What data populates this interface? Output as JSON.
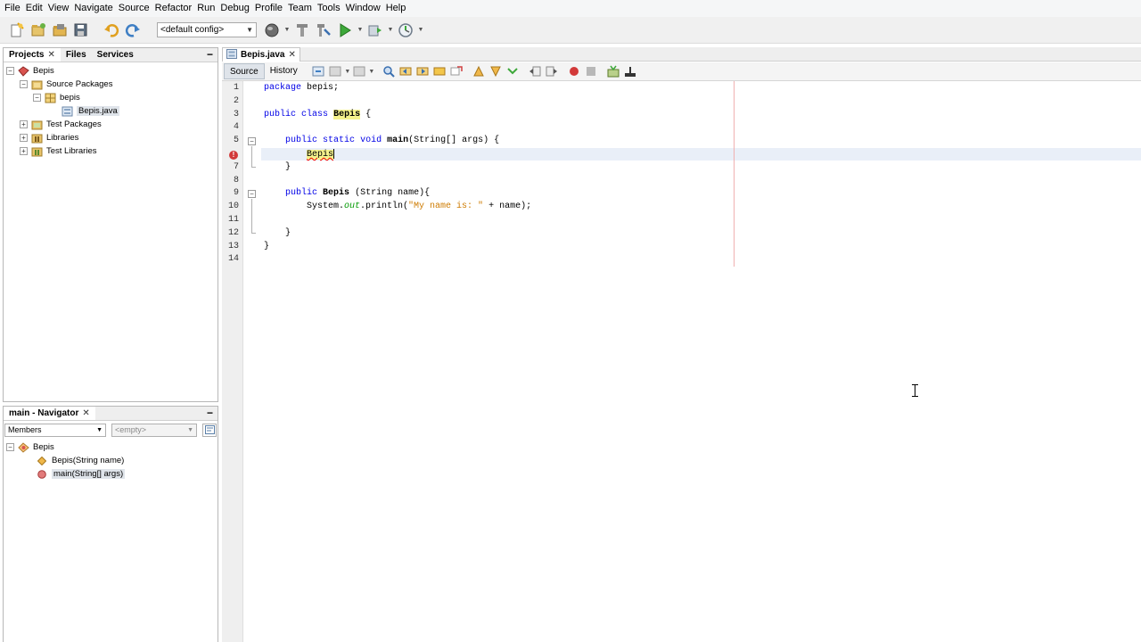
{
  "menu": [
    "File",
    "Edit",
    "View",
    "Navigate",
    "Source",
    "Refactor",
    "Run",
    "Debug",
    "Profile",
    "Team",
    "Tools",
    "Window",
    "Help"
  ],
  "toolbar": {
    "config_value": "<default config>",
    "icons": [
      "new-file-icon",
      "new-project-icon",
      "open-project-icon",
      "save-all-icon",
      "undo-icon",
      "redo-icon",
      "config-select",
      "globe-icon",
      "clean-build-icon",
      "build-icon",
      "run-icon",
      "debug-icon",
      "profile-icon"
    ]
  },
  "projects_panel": {
    "tabs": [
      {
        "label": "Projects",
        "active": true,
        "closable": true
      },
      {
        "label": "Files",
        "active": false,
        "closable": false
      },
      {
        "label": "Services",
        "active": false,
        "closable": false
      }
    ],
    "minimize_label": "−",
    "tree": [
      {
        "label": "Bepis",
        "level": 0,
        "toggle": "−",
        "icon": "project-icon"
      },
      {
        "label": "Source Packages",
        "level": 1,
        "toggle": "−",
        "icon": "source-packages-icon"
      },
      {
        "label": "bepis",
        "level": 2,
        "toggle": "−",
        "icon": "package-icon"
      },
      {
        "label": "Bepis.java",
        "level": 3,
        "toggle": "",
        "icon": "java-file-icon",
        "selected": true
      },
      {
        "label": "Test Packages",
        "level": 1,
        "toggle": "+",
        "icon": "test-packages-icon"
      },
      {
        "label": "Libraries",
        "level": 1,
        "toggle": "+",
        "icon": "libraries-icon"
      },
      {
        "label": "Test Libraries",
        "level": 1,
        "toggle": "+",
        "icon": "test-libraries-icon"
      }
    ]
  },
  "navigator": {
    "title": "main - Navigator",
    "members_label": "Members",
    "filter_placeholder": "<empty>",
    "tree": [
      {
        "label": "Bepis",
        "icon": "class-icon",
        "level": 0
      },
      {
        "label": "Bepis(String name)",
        "icon": "constructor-icon",
        "level": 1
      },
      {
        "label": "main(String[] args)",
        "icon": "method-icon",
        "level": 1,
        "selected": true
      }
    ]
  },
  "editor": {
    "file_tab": "Bepis.java",
    "view_tabs": [
      "Source",
      "History"
    ],
    "active_view": "Source",
    "lines": [
      {
        "num": "1",
        "code": [
          {
            "t": "package",
            "c": "kw"
          },
          {
            "t": " bepis;",
            "c": ""
          }
        ]
      },
      {
        "num": "2",
        "code": []
      },
      {
        "num": "3",
        "code": [
          {
            "t": "public",
            "c": "kw"
          },
          {
            "t": " ",
            "c": ""
          },
          {
            "t": "class",
            "c": "kw"
          },
          {
            "t": " ",
            "c": ""
          },
          {
            "t": "Bepis",
            "c": "cls hl"
          },
          {
            "t": " {",
            "c": ""
          }
        ]
      },
      {
        "num": "4",
        "code": []
      },
      {
        "num": "5",
        "code": [
          {
            "t": "    ",
            "c": ""
          },
          {
            "t": "public",
            "c": "kw"
          },
          {
            "t": " ",
            "c": ""
          },
          {
            "t": "static",
            "c": "kw"
          },
          {
            "t": " ",
            "c": ""
          },
          {
            "t": "void",
            "c": "kw"
          },
          {
            "t": " ",
            "c": ""
          },
          {
            "t": "main",
            "c": "cls"
          },
          {
            "t": "(String[] args) {",
            "c": ""
          }
        ]
      },
      {
        "num": "",
        "code": [
          {
            "t": "        ",
            "c": ""
          },
          {
            "t": "Bepis",
            "c": "hl err-underline"
          }
        ]
      },
      {
        "num": "7",
        "code": [
          {
            "t": "    }",
            "c": ""
          }
        ]
      },
      {
        "num": "8",
        "code": []
      },
      {
        "num": "9",
        "code": [
          {
            "t": "    ",
            "c": ""
          },
          {
            "t": "public",
            "c": "kw"
          },
          {
            "t": " ",
            "c": ""
          },
          {
            "t": "Bepis",
            "c": "cls"
          },
          {
            "t": " (String name){",
            "c": ""
          }
        ]
      },
      {
        "num": "10",
        "code": [
          {
            "t": "        System.",
            "c": ""
          },
          {
            "t": "out",
            "c": "fld"
          },
          {
            "t": ".println(",
            "c": ""
          },
          {
            "t": "\"My name is: \"",
            "c": "str"
          },
          {
            "t": " + name);",
            "c": ""
          }
        ]
      },
      {
        "num": "11",
        "code": []
      },
      {
        "num": "12",
        "code": [
          {
            "t": "    }",
            "c": ""
          }
        ]
      },
      {
        "num": "13",
        "code": [
          {
            "t": "}",
            "c": ""
          }
        ]
      },
      {
        "num": "14",
        "code": []
      }
    ]
  },
  "colors": {
    "keyword": "#0000e6",
    "string": "#ce7b00",
    "field": "#009900",
    "highlight": "#f5f28c",
    "error": "#d23939",
    "current_line": "#e9eff8"
  }
}
